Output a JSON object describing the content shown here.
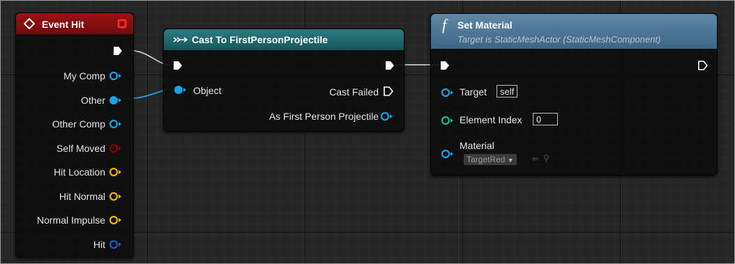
{
  "colors": {
    "event_header": "#8f1010",
    "cast_header": "#1f6a6f",
    "function_header": "#4e7592",
    "object_pin": "#1aa3e8",
    "struct_pin": "#f2b400",
    "int_pin": "#21c080",
    "bool_pin": "#8b0000",
    "hit_pin": "#1e5ec8",
    "exec": "#ffffff"
  },
  "event_node": {
    "title": "Event Hit",
    "title_icon": "diamond-event-icon",
    "delegate_icon": "red-delegate-square-icon",
    "pins": [
      {
        "label": "My Comp",
        "type": "object"
      },
      {
        "label": "Other",
        "type": "object"
      },
      {
        "label": "Other Comp",
        "type": "object"
      },
      {
        "label": "Self Moved",
        "type": "bool"
      },
      {
        "label": "Hit Location",
        "type": "vector"
      },
      {
        "label": "Hit Normal",
        "type": "vector"
      },
      {
        "label": "Normal Impulse",
        "type": "vector"
      },
      {
        "label": "Hit",
        "type": "hit-result"
      }
    ]
  },
  "cast_node": {
    "title": "Cast To FirstPersonProjectile",
    "title_icon": "cast-arrow-icon",
    "input_object_label": "Object",
    "cast_failed_label": "Cast Failed",
    "as_label": "As First Person Projectile"
  },
  "set_material_node": {
    "title": "Set Material",
    "title_icon": "function-f-icon",
    "subtitle": "Target is StaticMeshActor (StaticMeshComponent)",
    "target_label": "Target",
    "target_value": "self",
    "element_index_label": "Element Index",
    "element_index_value": "0",
    "material_label": "Material",
    "material_value": "TargetRed"
  }
}
